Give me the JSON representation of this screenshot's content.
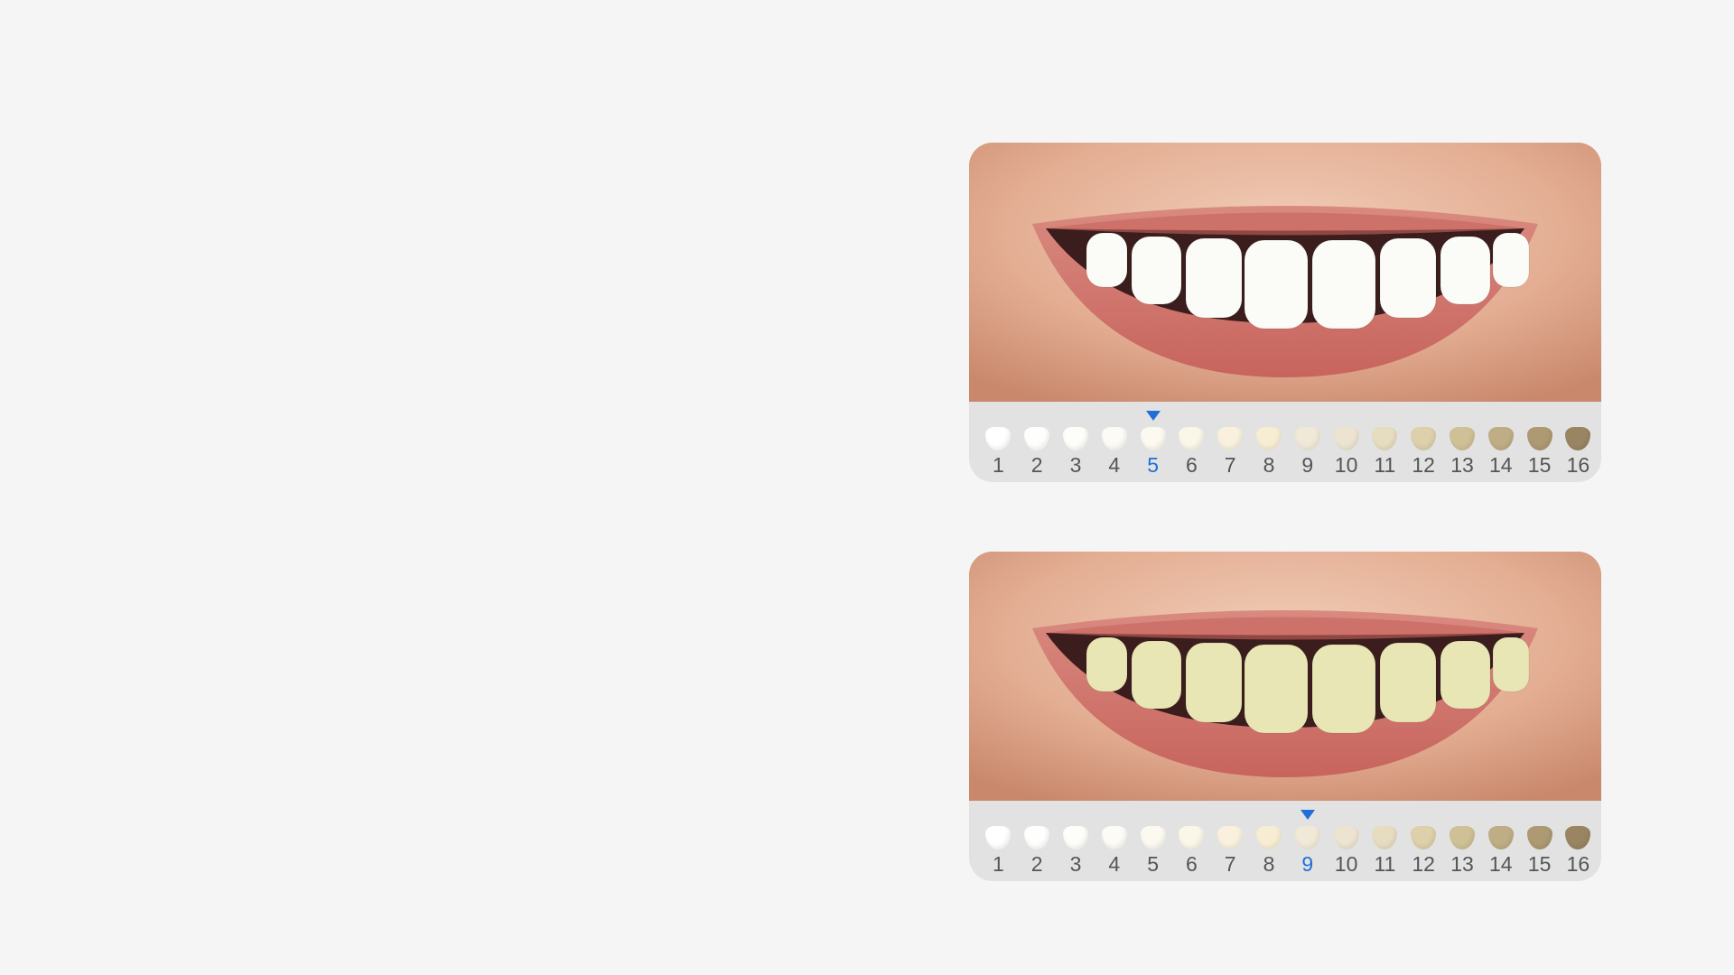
{
  "comparison": [
    {
      "id": "top",
      "teeth_color": "#fbfbf8",
      "selected_shade": "5"
    },
    {
      "id": "bottom",
      "teeth_color": "#e9e6b6",
      "selected_shade": "9"
    }
  ],
  "shade_guide": {
    "accent_color": "#1f6fd6",
    "shades": [
      {
        "label": "1",
        "color": "#ffffff"
      },
      {
        "label": "2",
        "color": "#fefefd"
      },
      {
        "label": "3",
        "color": "#fdfdfa"
      },
      {
        "label": "4",
        "color": "#fcfbf5"
      },
      {
        "label": "5",
        "color": "#fbf9f0"
      },
      {
        "label": "6",
        "color": "#faf6e8"
      },
      {
        "label": "7",
        "color": "#f9f1dd"
      },
      {
        "label": "8",
        "color": "#f7edd3"
      },
      {
        "label": "9",
        "color": "#f1e9d7"
      },
      {
        "label": "10",
        "color": "#ece4d0"
      },
      {
        "label": "11",
        "color": "#e6dcc0"
      },
      {
        "label": "12",
        "color": "#ddd0ab"
      },
      {
        "label": "13",
        "color": "#cfc096"
      },
      {
        "label": "14",
        "color": "#bfae85"
      },
      {
        "label": "15",
        "color": "#ad9a73"
      },
      {
        "label": "16",
        "color": "#9a8563"
      }
    ]
  }
}
